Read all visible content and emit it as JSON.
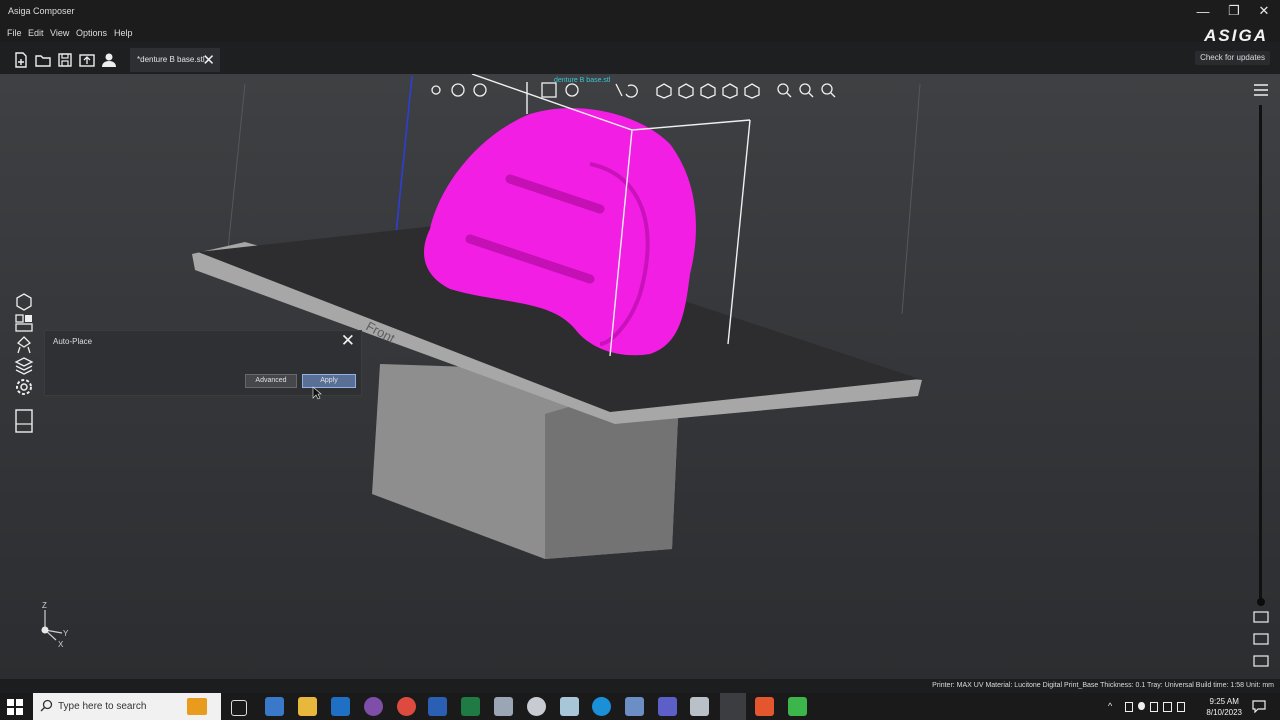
{
  "window": {
    "title": "Asiga Composer",
    "brand": "ASIGA",
    "minimize": "—",
    "restore": "❐",
    "close": "✕"
  },
  "menu": [
    "File",
    "Edit",
    "View",
    "Options",
    "Help"
  ],
  "tab": {
    "label": "*denture B base.stl",
    "close": "✕"
  },
  "updates_label": "Check for updates",
  "viewport": {
    "model_label": "denture B base.stl",
    "platform_label": "Front"
  },
  "autoplace": {
    "title": "Auto-Place",
    "close": "✕",
    "advanced_label": "Advanced",
    "apply_label": "Apply"
  },
  "axis": {
    "z": "Z",
    "y": "Y",
    "x": "X"
  },
  "status_bar": "Printer: MAX UV  Material: Lucitone Digital Print_Base  Thickness: 0.1  Tray: Universal  Build time: 1:58  Unit: mm",
  "taskbar": {
    "search_placeholder": "Type here to search",
    "time": "9:25 AM",
    "date": "8/10/2023"
  },
  "colors": {
    "model": "#f21ee3",
    "accent_blue": "#2e3fd6",
    "apply": "#5a6f95"
  }
}
